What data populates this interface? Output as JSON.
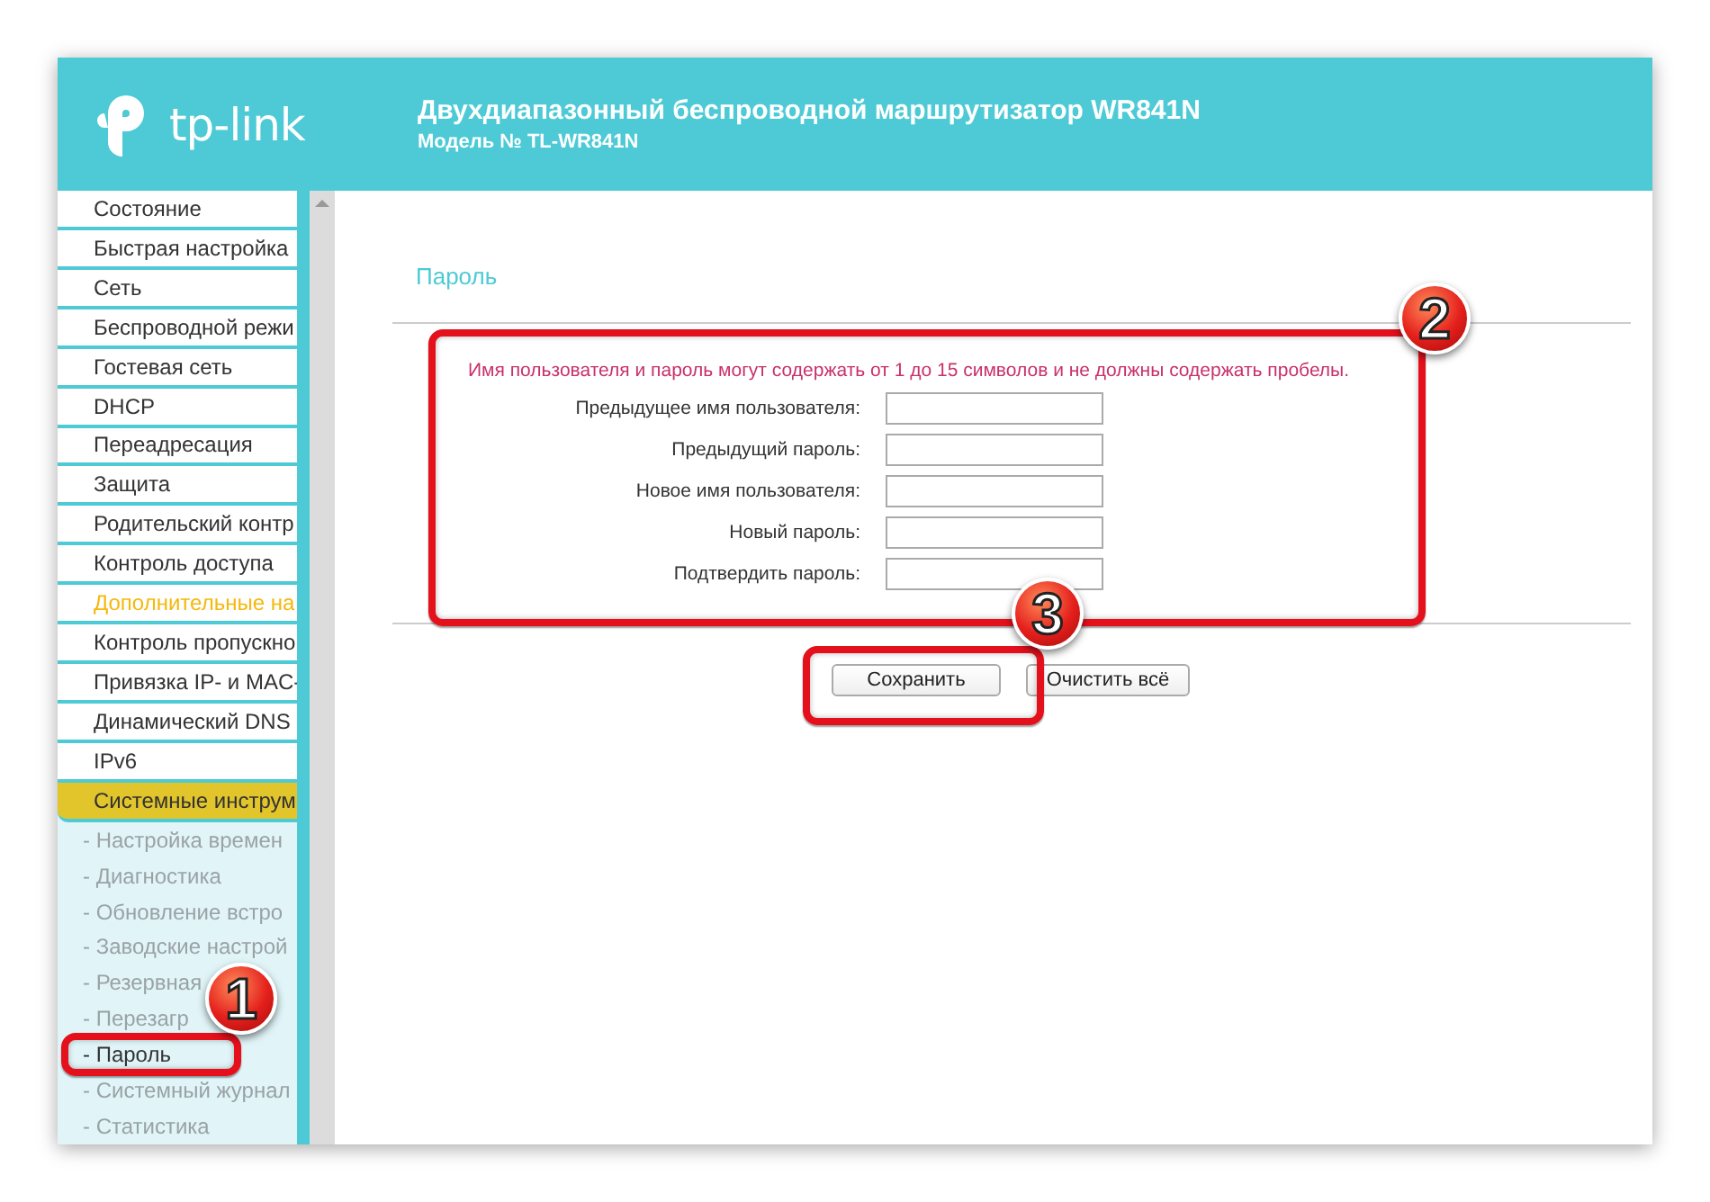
{
  "header": {
    "logo_text": "tp-link",
    "title": "Двухдиапазонный беспроводной маршрутизатор WR841N",
    "model": "Модель № TL-WR841N"
  },
  "sidebar": {
    "items": [
      {
        "label": "Состояние",
        "kind": "main",
        "selected": false
      },
      {
        "label": "Быстрая настройка",
        "kind": "main",
        "selected": false
      },
      {
        "label": "Сеть",
        "kind": "main",
        "selected": false
      },
      {
        "label": "Беспроводной режи",
        "kind": "main",
        "selected": false
      },
      {
        "label": "Гостевая сеть",
        "kind": "main",
        "selected": false
      },
      {
        "label": "DHCP",
        "kind": "main",
        "selected": false
      },
      {
        "label": "Переадресация",
        "kind": "main",
        "selected": false
      },
      {
        "label": "Защита",
        "kind": "main",
        "selected": false
      },
      {
        "label": "Родительский контр",
        "kind": "main",
        "selected": false
      },
      {
        "label": "Контроль доступа",
        "kind": "main",
        "selected": false
      },
      {
        "label": "Дополнительные на",
        "kind": "accent",
        "selected": false
      },
      {
        "label": "Контроль пропускно",
        "kind": "main",
        "selected": false
      },
      {
        "label": "Привязка IP- и MAC-",
        "kind": "main",
        "selected": false
      },
      {
        "label": "Динамический DNS",
        "kind": "main",
        "selected": false
      },
      {
        "label": "IPv6",
        "kind": "main",
        "selected": false
      },
      {
        "label": "Системные инструм",
        "kind": "main",
        "selected": true
      },
      {
        "label": "- Настройка времен",
        "kind": "sub",
        "selected": false
      },
      {
        "label": "- Диагностика",
        "kind": "sub",
        "selected": false
      },
      {
        "label": "- Обновление встро",
        "kind": "sub",
        "selected": false
      },
      {
        "label": "- Заводские настрой",
        "kind": "sub",
        "selected": false
      },
      {
        "label": "- Резервная",
        "kind": "sub",
        "selected": false
      },
      {
        "label": "- Перезагр",
        "kind": "sub",
        "selected": false
      },
      {
        "label": "- Пароль",
        "kind": "sub",
        "selected": true
      },
      {
        "label": "- Системный журнал",
        "kind": "sub",
        "selected": false
      },
      {
        "label": "- Статистика",
        "kind": "sub",
        "selected": false
      }
    ]
  },
  "content": {
    "title": "Пароль",
    "hint": "Имя пользователя и пароль могут содержать от 1 до 15 символов и не должны содержать пробелы.",
    "fields": [
      {
        "label": "Предыдущее имя пользователя:"
      },
      {
        "label": "Предыдущий пароль:"
      },
      {
        "label": "Новое имя пользователя:"
      },
      {
        "label": "Новый пароль:"
      },
      {
        "label": "Подтвердить пароль:"
      }
    ],
    "buttons": [
      "Сохранить",
      "Очистить всё"
    ]
  },
  "annotations": [
    {
      "number": "1"
    },
    {
      "number": "2"
    },
    {
      "number": "3"
    }
  ]
}
